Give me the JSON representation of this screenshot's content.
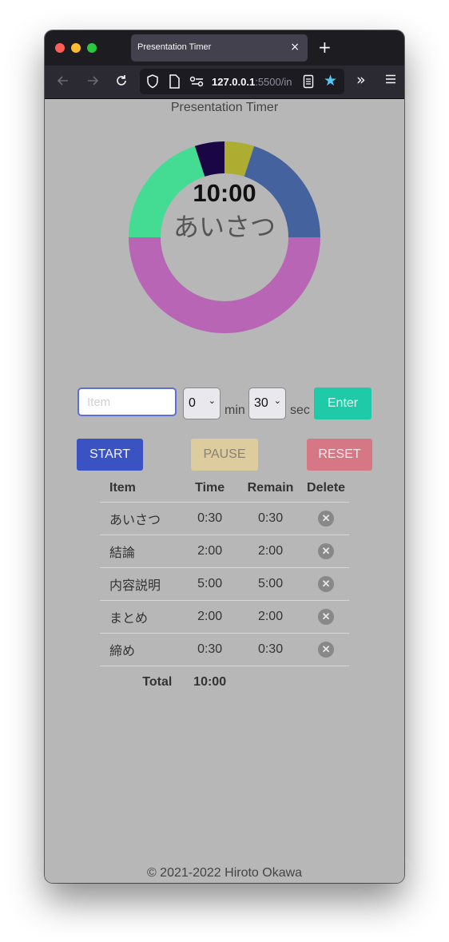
{
  "browser": {
    "tab_title": "Presentation Timer",
    "tab_close": "×",
    "new_tab": "+",
    "url_host": "127.0.0.1",
    "url_rest": ":5500/in"
  },
  "app": {
    "title": "Presentation Timer",
    "clock": "10:00",
    "current_item": "あいさつ"
  },
  "chart_data": {
    "type": "pie",
    "subtype": "donut",
    "categories": [
      "あいさつ",
      "結論",
      "内容説明",
      "まとめ",
      "締め"
    ],
    "values": [
      30,
      120,
      300,
      120,
      30
    ],
    "unit": "seconds",
    "colors": [
      "#adad31",
      "#44639e",
      "#b865b5",
      "#44dc92",
      "#1a0645"
    ]
  },
  "form": {
    "item_placeholder": "Item",
    "min_value": "0",
    "min_label": "min",
    "sec_value": "30",
    "sec_label": "sec",
    "enter_label": "Enter"
  },
  "controls": {
    "start_label": "START",
    "pause_label": "PAUSE",
    "reset_label": "RESET"
  },
  "table": {
    "headers": [
      "Item",
      "Time",
      "Remain",
      "Delete"
    ],
    "rows": [
      {
        "item": "あいさつ",
        "time": "0:30",
        "remain": "0:30"
      },
      {
        "item": "結論",
        "time": "2:00",
        "remain": "2:00"
      },
      {
        "item": "内容説明",
        "time": "5:00",
        "remain": "5:00"
      },
      {
        "item": "まとめ",
        "time": "2:00",
        "remain": "2:00"
      },
      {
        "item": "締め",
        "time": "0:30",
        "remain": "0:30"
      }
    ],
    "total_label": "Total",
    "total_time": "10:00"
  },
  "footer": "© 2021-2022 Hiroto Okawa"
}
